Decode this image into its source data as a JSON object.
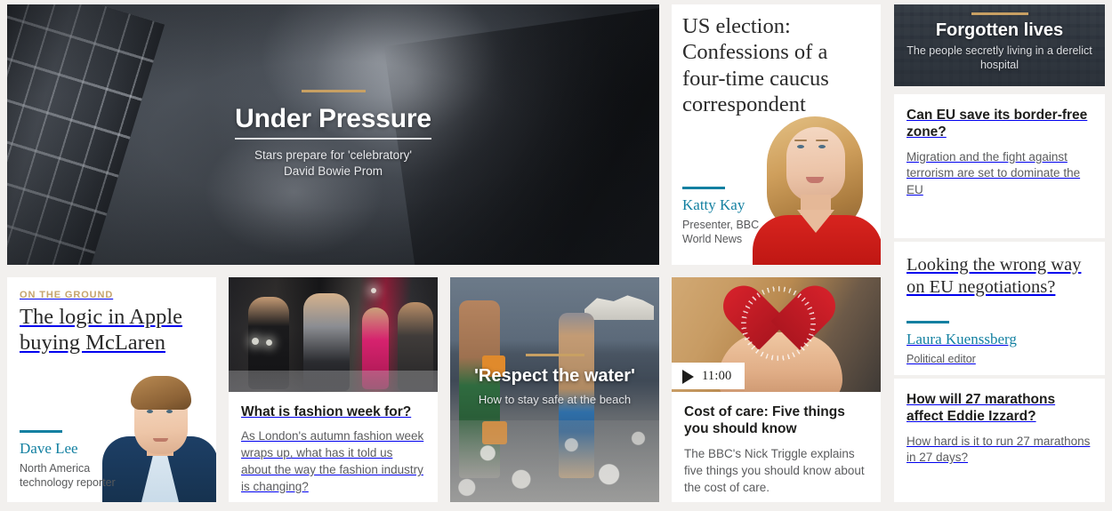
{
  "theme": {
    "background": "#f2f0ee",
    "card_background": "#ffffff",
    "gold_accent": "#c8a063",
    "byline_blue": "#1380a1",
    "kicker_gold": "#c5a46e",
    "heading_dark": "#1d1d1b",
    "summary_grey": "#5b5c5e"
  },
  "hero": {
    "name": "under-pressure",
    "title": "Under Pressure",
    "subtitle_line1": "Stars prepare for 'celebratory'",
    "subtitle_line2": "David Bowie Prom",
    "image_alt": "David Bowie holding a guitar, black and white"
  },
  "election": {
    "name": "us-election",
    "title": "US election: Confessions of a four-time caucus correspondent",
    "byline": {
      "name": "Katty Kay",
      "role_line1": "Presenter, BBC",
      "role_line2": "World News"
    },
    "image_alt": "Katty Kay portrait in a red dress"
  },
  "forgotten": {
    "name": "forgotten-lives",
    "title": "Forgotten lives",
    "subtitle": "The people secretly living in a derelict hospital",
    "image_alt": "Derelict hospital building"
  },
  "right_column": [
    {
      "name": "can-eu-save-border-free-zone",
      "style": "bold",
      "title": "Can EU save its border-free zone?",
      "summary": "Migration and the fight against terrorism are set to dominate the EU"
    },
    {
      "name": "looking-wrong-way-eu-negotiations",
      "style": "serif",
      "title": "Looking the wrong way on EU negotiations?",
      "byline": {
        "name": "Laura Kuenssberg",
        "role": "Political editor"
      }
    },
    {
      "name": "how-will-27-marathons-affect-eddie-izzard",
      "style": "bold",
      "title": "How will 27 marathons affect Eddie Izzard?",
      "summary": "How hard is it to run 27 marathons in 27 days?"
    }
  ],
  "bottom_row": {
    "apple": {
      "name": "logic-in-apple-buying-mclaren",
      "kicker": "ON THE GROUND",
      "title": "The logic in Apple buying McLaren",
      "byline": {
        "name": "Dave Lee",
        "role_line1": "North America",
        "role_line2": "technology reporter"
      },
      "image_alt": "Dave Lee portrait in a blue suit"
    },
    "fashion": {
      "name": "what-is-fashion-week-for",
      "title": "What is fashion week for?",
      "summary": "As London's autumn fashion week wraps up, what has it told us about the way the fashion industry is changing?",
      "image_alt": "Models walking a fashion show runway"
    },
    "water": {
      "name": "respect-the-water",
      "title": "'Respect the water'",
      "subtitle": "How to stay safe at the beach",
      "image_alt": "Two boys walking on a pebble beach towards the sea"
    },
    "care": {
      "name": "cost-of-care-five-things",
      "media_duration": "11:00",
      "media_icon": "play-icon",
      "title": "Cost of care: Five things you should know",
      "summary": "The BBC's Nick Triggle explains five things you should know about the cost of care.",
      "image_alt": "Hands holding a red felt heart"
    }
  }
}
